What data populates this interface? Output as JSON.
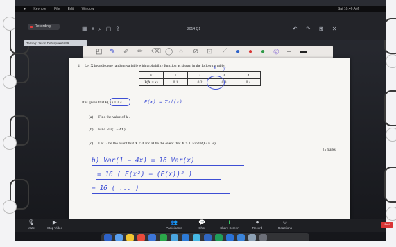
{
  "menubar": {
    "apple": "",
    "items": [
      "Keynote",
      "File",
      "Edit",
      "Window"
    ],
    "clock": "Sat 10:46 AM"
  },
  "zoom": {
    "recording_label": "Recording",
    "tooltip": "Talking: Jason Deh spoke6699",
    "window_title": "2014 Q1",
    "toolbar_right": "↶ ↷ ⊞ ✕"
  },
  "annotation_tools": {
    "icons": [
      "select-icon",
      "pen-icon",
      "highlighter-icon",
      "pencil-icon",
      "eraser-icon",
      "stamp-icon",
      "lasso-icon",
      "ruler-icon",
      "text-icon",
      "color-blue",
      "color-red",
      "color-green",
      "more-icon",
      "minus-icon"
    ]
  },
  "question": {
    "number": "4",
    "stem": "Let X be a discrete random variable with probability function as shown in the following table.",
    "table": {
      "row_x_label": "x",
      "row_p_label": "P(X = x)",
      "x_values": [
        "1",
        "2",
        "3",
        "4"
      ],
      "p_values": [
        "0.1",
        "0.2",
        "0.3",
        "0.4"
      ],
      "annotations": [
        "k",
        "y"
      ]
    },
    "given": "It is given that E(X) = 3.4.",
    "handwritten_given": "E(x) = Σxf(x) ...",
    "parts": [
      {
        "label": "(a)",
        "text": "Find the value of k ."
      },
      {
        "label": "(b)",
        "text": "Find Var(1 − 4X)."
      },
      {
        "label": "(c)",
        "text": "Let G be the event that X < 4 and H be the event that X ≥ 1. Find P(G ∩ H)."
      }
    ],
    "marks": "[5 marks]",
    "handwritten_work": [
      "b) Var(1 − 4x) = 16 Var(x)",
      "= 16 ( E(x²) − (E(x))² )",
      "= 16 ( ... )"
    ]
  },
  "bottom_bar": {
    "buttons": [
      {
        "label": "Mute",
        "icon": "microphone-icon"
      },
      {
        "label": "Stop Video",
        "icon": "camera-icon"
      },
      {
        "label": "Participants",
        "icon": "people-icon"
      },
      {
        "label": "Chat",
        "icon": "chat-icon"
      },
      {
        "label": "Share Screen",
        "icon": "share-icon"
      },
      {
        "label": "Record",
        "icon": "record-icon"
      },
      {
        "label": "Reactions",
        "icon": "smile-icon"
      }
    ],
    "end_label": "End"
  },
  "colors": {
    "ink": "#3e4fd4",
    "end": "#d93535",
    "recording": "#e23b3b"
  }
}
